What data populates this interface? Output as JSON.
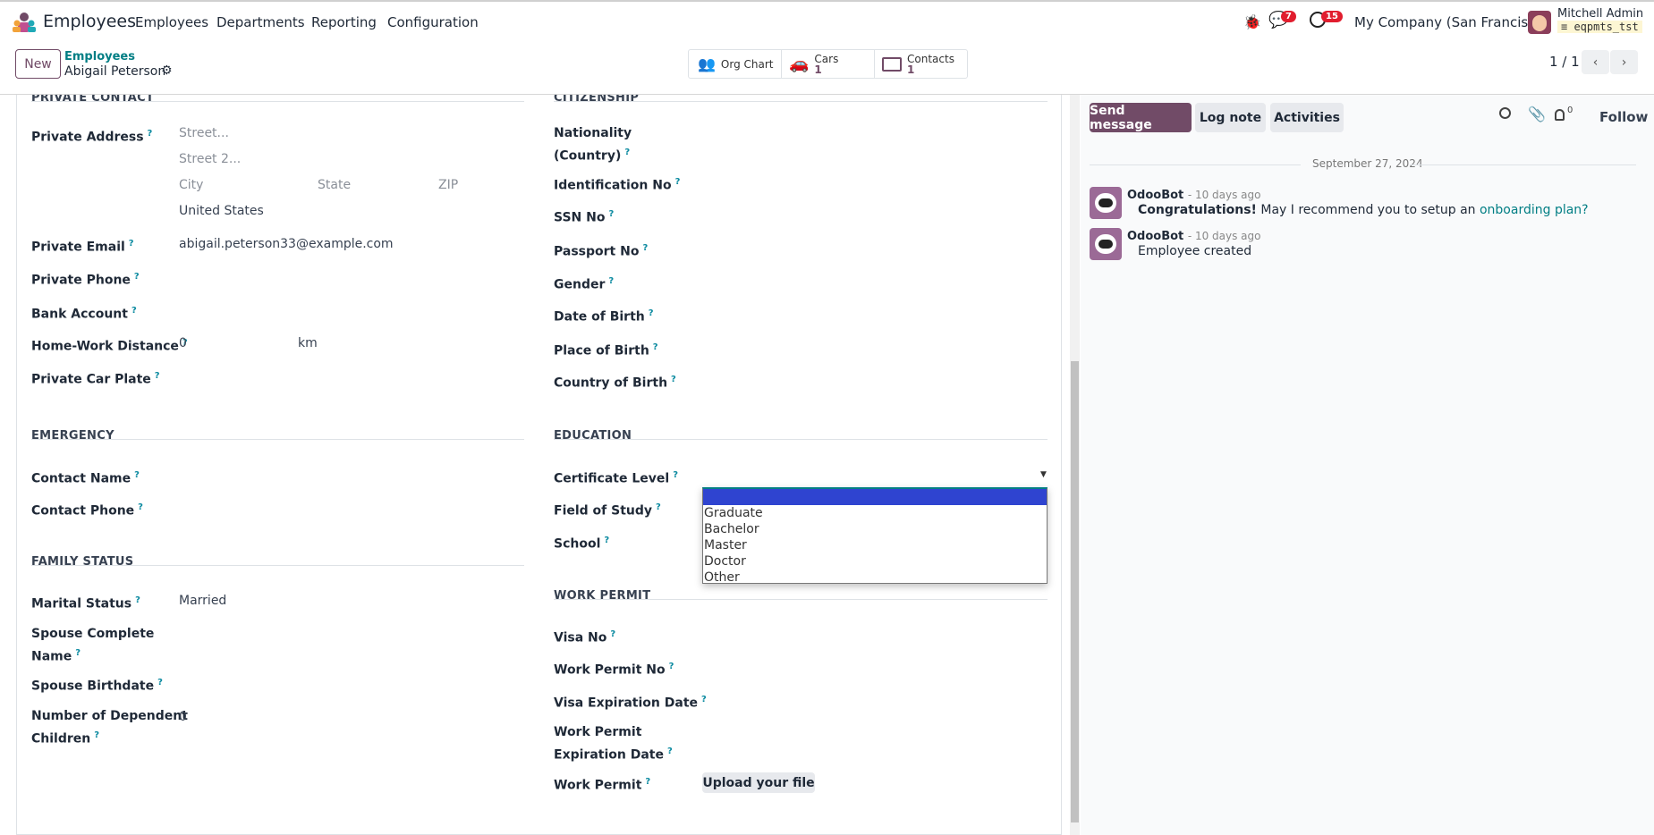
{
  "navbar": {
    "app_name": "Employees",
    "menu": [
      "Employees",
      "Departments",
      "Reporting",
      "Configuration"
    ],
    "messages_badge": "7",
    "activities_badge": "15",
    "company": "My Company (San Francisco)",
    "user_name": "Mitchell Admin",
    "database": "eqpmts_tst"
  },
  "control_panel": {
    "new_label": "New",
    "breadcrumb_parent": "Employees",
    "record_name": "Abigail Peterson",
    "smart_buttons": [
      {
        "label": "Org Chart",
        "icon": "org-chart-icon"
      },
      {
        "label": "Cars",
        "count": "1",
        "icon": "car-icon"
      },
      {
        "label": "Contacts",
        "count": "1",
        "icon": "contact-card-icon"
      }
    ],
    "pager": "1 / 1"
  },
  "form": {
    "private_contact": {
      "title": "PRIVATE CONTACT",
      "address_label": "Private Address",
      "street_ph": "Street...",
      "street2_ph": "Street 2...",
      "city_ph": "City",
      "state_ph": "State",
      "zip_ph": "ZIP",
      "country": "United States",
      "email_label": "Private Email",
      "email": "abigail.peterson33@example.com",
      "phone_label": "Private Phone",
      "bank_label": "Bank Account",
      "distance_label": "Home-Work Distance",
      "distance": "0",
      "distance_unit": "km",
      "car_plate_label": "Private Car Plate"
    },
    "emergency": {
      "title": "EMERGENCY",
      "contact_name_label": "Contact Name",
      "contact_phone_label": "Contact Phone"
    },
    "family": {
      "title": "FAMILY STATUS",
      "marital_label": "Marital Status",
      "marital": "Married",
      "spouse_name_label_1": "Spouse Complete",
      "spouse_name_label_2": "Name",
      "spouse_birth_label": "Spouse Birthdate",
      "children_label_1": "Number of Dependent",
      "children_label_2": "Children",
      "children": "0"
    },
    "citizenship": {
      "title": "CITIZENSHIP",
      "nationality_label_1": "Nationality",
      "nationality_label_2": "(Country)",
      "id_label": "Identification No",
      "ssn_label": "SSN No",
      "passport_label": "Passport No",
      "gender_label": "Gender",
      "dob_label": "Date of Birth",
      "pob_label": "Place of Birth",
      "cob_label": "Country of Birth"
    },
    "education": {
      "title": "EDUCATION",
      "certificate_label": "Certificate Level",
      "field_label": "Field of Study",
      "school_label": "School",
      "certificate_options": [
        "",
        "Graduate",
        "Bachelor",
        "Master",
        "Doctor",
        "Other"
      ]
    },
    "work_permit": {
      "title": "WORK PERMIT",
      "visa_label": "Visa No",
      "permit_no_label": "Work Permit No",
      "visa_exp_label": "Visa Expiration Date",
      "permit_exp_label_1": "Work Permit",
      "permit_exp_label_2": "Expiration Date",
      "permit_label": "Work Permit",
      "upload_label": "Upload your file"
    }
  },
  "chatter": {
    "send_message": "Send message",
    "log_note": "Log note",
    "activities": "Activities",
    "followers_count": "0",
    "follow": "Follow",
    "date": "September 27, 2024",
    "messages": [
      {
        "author": "OdooBot",
        "time": "- 10 days ago",
        "bold": "Congratulations!",
        "text": " May I recommend you to setup an ",
        "link": "onboarding plan?"
      },
      {
        "author": "OdooBot",
        "time": "- 10 days ago",
        "text": "Employee created"
      }
    ]
  },
  "colors": {
    "brand": "#714b67",
    "teal": "#017e84",
    "highlight": "#2f44d0",
    "badge": "#e11d2e"
  }
}
